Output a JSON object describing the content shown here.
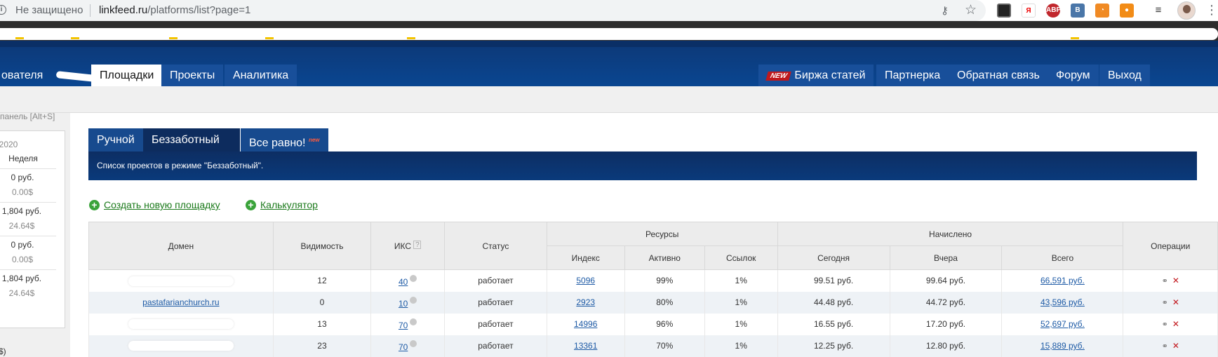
{
  "browser": {
    "security_label": "Не защищено",
    "url_host": "linkfeed.ru",
    "url_path": "/platforms/list?page=1",
    "extensions": [
      {
        "icon": "abp-icon",
        "label": "ABP",
        "color": "#c1272d"
      },
      {
        "icon": "vk-icon",
        "label": "B",
        "color": "#4a76a8"
      },
      {
        "icon": "rss-icon",
        "label": "",
        "color": "#f08a24"
      },
      {
        "icon": "ok-icon",
        "label": "",
        "color": "#f28c17"
      }
    ]
  },
  "nav": {
    "left_partial": "ователя",
    "items": [
      "Площадки",
      "Проекты",
      "Аналитика"
    ],
    "new_badge": "NEW",
    "right_items": [
      "Биржа статей",
      "Партнерка",
      "Обратная связь",
      "Форум",
      "Выход"
    ]
  },
  "sidebar": {
    "hint": "панель [Alt+S]",
    "year": "2020",
    "week_label": "Неделя",
    "rows": [
      {
        "rub": "0 руб.",
        "usd": "0.00$"
      },
      {
        "rub": "1,804 руб.",
        "usd": "24.64$"
      },
      {
        "rub": "0 руб.",
        "usd": "0.00$"
      },
      {
        "rub": "1,804 руб.",
        "usd": "24.64$"
      }
    ],
    "footer": "$)"
  },
  "tabs": [
    {
      "label": "Ручной"
    },
    {
      "label": "Беззаботный"
    },
    {
      "label": "Все равно!",
      "badge": "new"
    }
  ],
  "banner": "Список проектов в режиме \"Беззаботный\".",
  "actions": {
    "create": "Создать новую площадку",
    "calc": "Калькулятор"
  },
  "table": {
    "headers": {
      "domain": "Домен",
      "visibility": "Видимость",
      "iks": "ИКС",
      "iks_help": "?",
      "status": "Статус",
      "resources": "Ресурсы",
      "index": "Индекс",
      "active": "Активно",
      "links": "Ссылок",
      "accrued": "Начислено",
      "today": "Сегодня",
      "yesterday": "Вчера",
      "total": "Всего",
      "ops": "Операции"
    },
    "rows": [
      {
        "domain": "",
        "visibility": "12",
        "iks": "40",
        "status": "работает",
        "index": "5096",
        "active": "99%",
        "links": "1%",
        "today": "99.51 руб.",
        "yesterday": "99.64 руб.",
        "total": "66,591 руб."
      },
      {
        "domain": "pastafarianchurch.ru",
        "visibility": "0",
        "iks": "10",
        "status": "работает",
        "index": "2923",
        "active": "80%",
        "links": "1%",
        "today": "44.48 руб.",
        "yesterday": "44.72 руб.",
        "total": "43,596 руб."
      },
      {
        "domain": "",
        "visibility": "13",
        "iks": "70",
        "status": "работает",
        "index": "14996",
        "active": "96%",
        "links": "1%",
        "today": "16.55 руб.",
        "yesterday": "17.20 руб.",
        "total": "52,697 руб."
      },
      {
        "domain": "",
        "visibility": "23",
        "iks": "70",
        "status": "работает",
        "index": "13361",
        "active": "70%",
        "links": "1%",
        "today": "12.25 руб.",
        "yesterday": "12.80 руб.",
        "total": "15,889 руб."
      }
    ]
  }
}
